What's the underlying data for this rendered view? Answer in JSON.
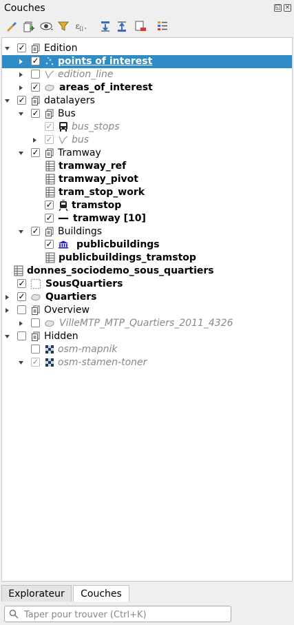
{
  "panel": {
    "title": "Couches"
  },
  "layers": [
    {
      "label": "Edition",
      "arrow": "down",
      "check": "on",
      "icon": "group-icon",
      "style": "",
      "depth": 0
    },
    {
      "label": "points of interest",
      "arrow": "right",
      "check": "on",
      "icon": "points-icon",
      "style": "b",
      "depth": 1,
      "selected": true
    },
    {
      "label": "edition_line",
      "arrow": "right",
      "check": "off",
      "icon": "line-icon",
      "style": "i",
      "depth": 1
    },
    {
      "label": "areas_of_interest",
      "arrow": "right",
      "check": "on",
      "icon": "polygon-icon",
      "style": "b",
      "depth": 1
    },
    {
      "label": "datalayers",
      "arrow": "down",
      "check": "on",
      "icon": "group-icon",
      "style": "",
      "depth": 0
    },
    {
      "label": "Bus",
      "arrow": "down",
      "check": "on",
      "icon": "group-icon",
      "style": "",
      "depth": 1
    },
    {
      "label": "bus_stops",
      "arrow": "",
      "check": "dis",
      "icon": "bus-icon",
      "style": "i",
      "depth": 2
    },
    {
      "label": "bus",
      "arrow": "right",
      "check": "dis",
      "icon": "line-icon",
      "style": "i",
      "depth": 2
    },
    {
      "label": "Tramway",
      "arrow": "down",
      "check": "on",
      "icon": "group-icon",
      "style": "",
      "depth": 1
    },
    {
      "label": "tramway_ref",
      "arrow": "",
      "check": "none",
      "icon": "table-icon",
      "style": "b",
      "depth": 2
    },
    {
      "label": "tramway_pivot",
      "arrow": "",
      "check": "none",
      "icon": "table-icon",
      "style": "b",
      "depth": 2
    },
    {
      "label": "tram_stop_work",
      "arrow": "",
      "check": "none",
      "icon": "table-icon",
      "style": "b",
      "depth": 2
    },
    {
      "label": "tramstop",
      "arrow": "",
      "check": "on",
      "icon": "tram-icon",
      "style": "b",
      "depth": 2
    },
    {
      "label": "tramway [10]",
      "arrow": "",
      "check": "on",
      "icon": "solid-line-icon",
      "style": "b",
      "depth": 2
    },
    {
      "label": "Buildings",
      "arrow": "down",
      "check": "on",
      "icon": "group-icon",
      "style": "",
      "depth": 1
    },
    {
      "label": "publicbuildings",
      "arrow": "",
      "check": "on",
      "icon": "building-icon",
      "style": "b",
      "depth": 2
    },
    {
      "label": "publicbuildings_tramstop",
      "arrow": "",
      "check": "none",
      "icon": "table-icon",
      "style": "b",
      "depth": 2
    },
    {
      "label": "donnes_sociodemo_sous_quartiers",
      "arrow": "",
      "check": "none",
      "icon": "table-icon",
      "style": "b",
      "depth": -1
    },
    {
      "label": "SousQuartiers",
      "arrow": "",
      "check": "on",
      "icon": "dashed-polygon-icon",
      "style": "b",
      "depth": 0
    },
    {
      "label": "Quartiers",
      "arrow": "right",
      "check": "on",
      "icon": "polygon-icon",
      "style": "b",
      "depth": 0
    },
    {
      "label": "Overview",
      "arrow": "right",
      "check": "off",
      "icon": "group-icon",
      "style": "",
      "depth": 0
    },
    {
      "label": "VilleMTP_MTP_Quartiers_2011_4326",
      "arrow": "right",
      "check": "off",
      "icon": "polygon-icon",
      "style": "i",
      "depth": 1
    },
    {
      "label": "Hidden",
      "arrow": "down",
      "check": "off",
      "icon": "group-icon",
      "style": "",
      "depth": 0
    },
    {
      "label": "osm-mapnik",
      "arrow": "",
      "check": "off",
      "icon": "raster-icon",
      "style": "i",
      "depth": 1
    },
    {
      "label": "osm-stamen-toner",
      "arrow": "down",
      "check": "dis",
      "icon": "raster-icon",
      "style": "i",
      "depth": 1
    }
  ],
  "tabs": [
    {
      "label": "Explorateur",
      "active": false
    },
    {
      "label": "Couches",
      "active": true
    }
  ],
  "search": {
    "placeholder": "Taper pour trouver (Ctrl+K)"
  }
}
